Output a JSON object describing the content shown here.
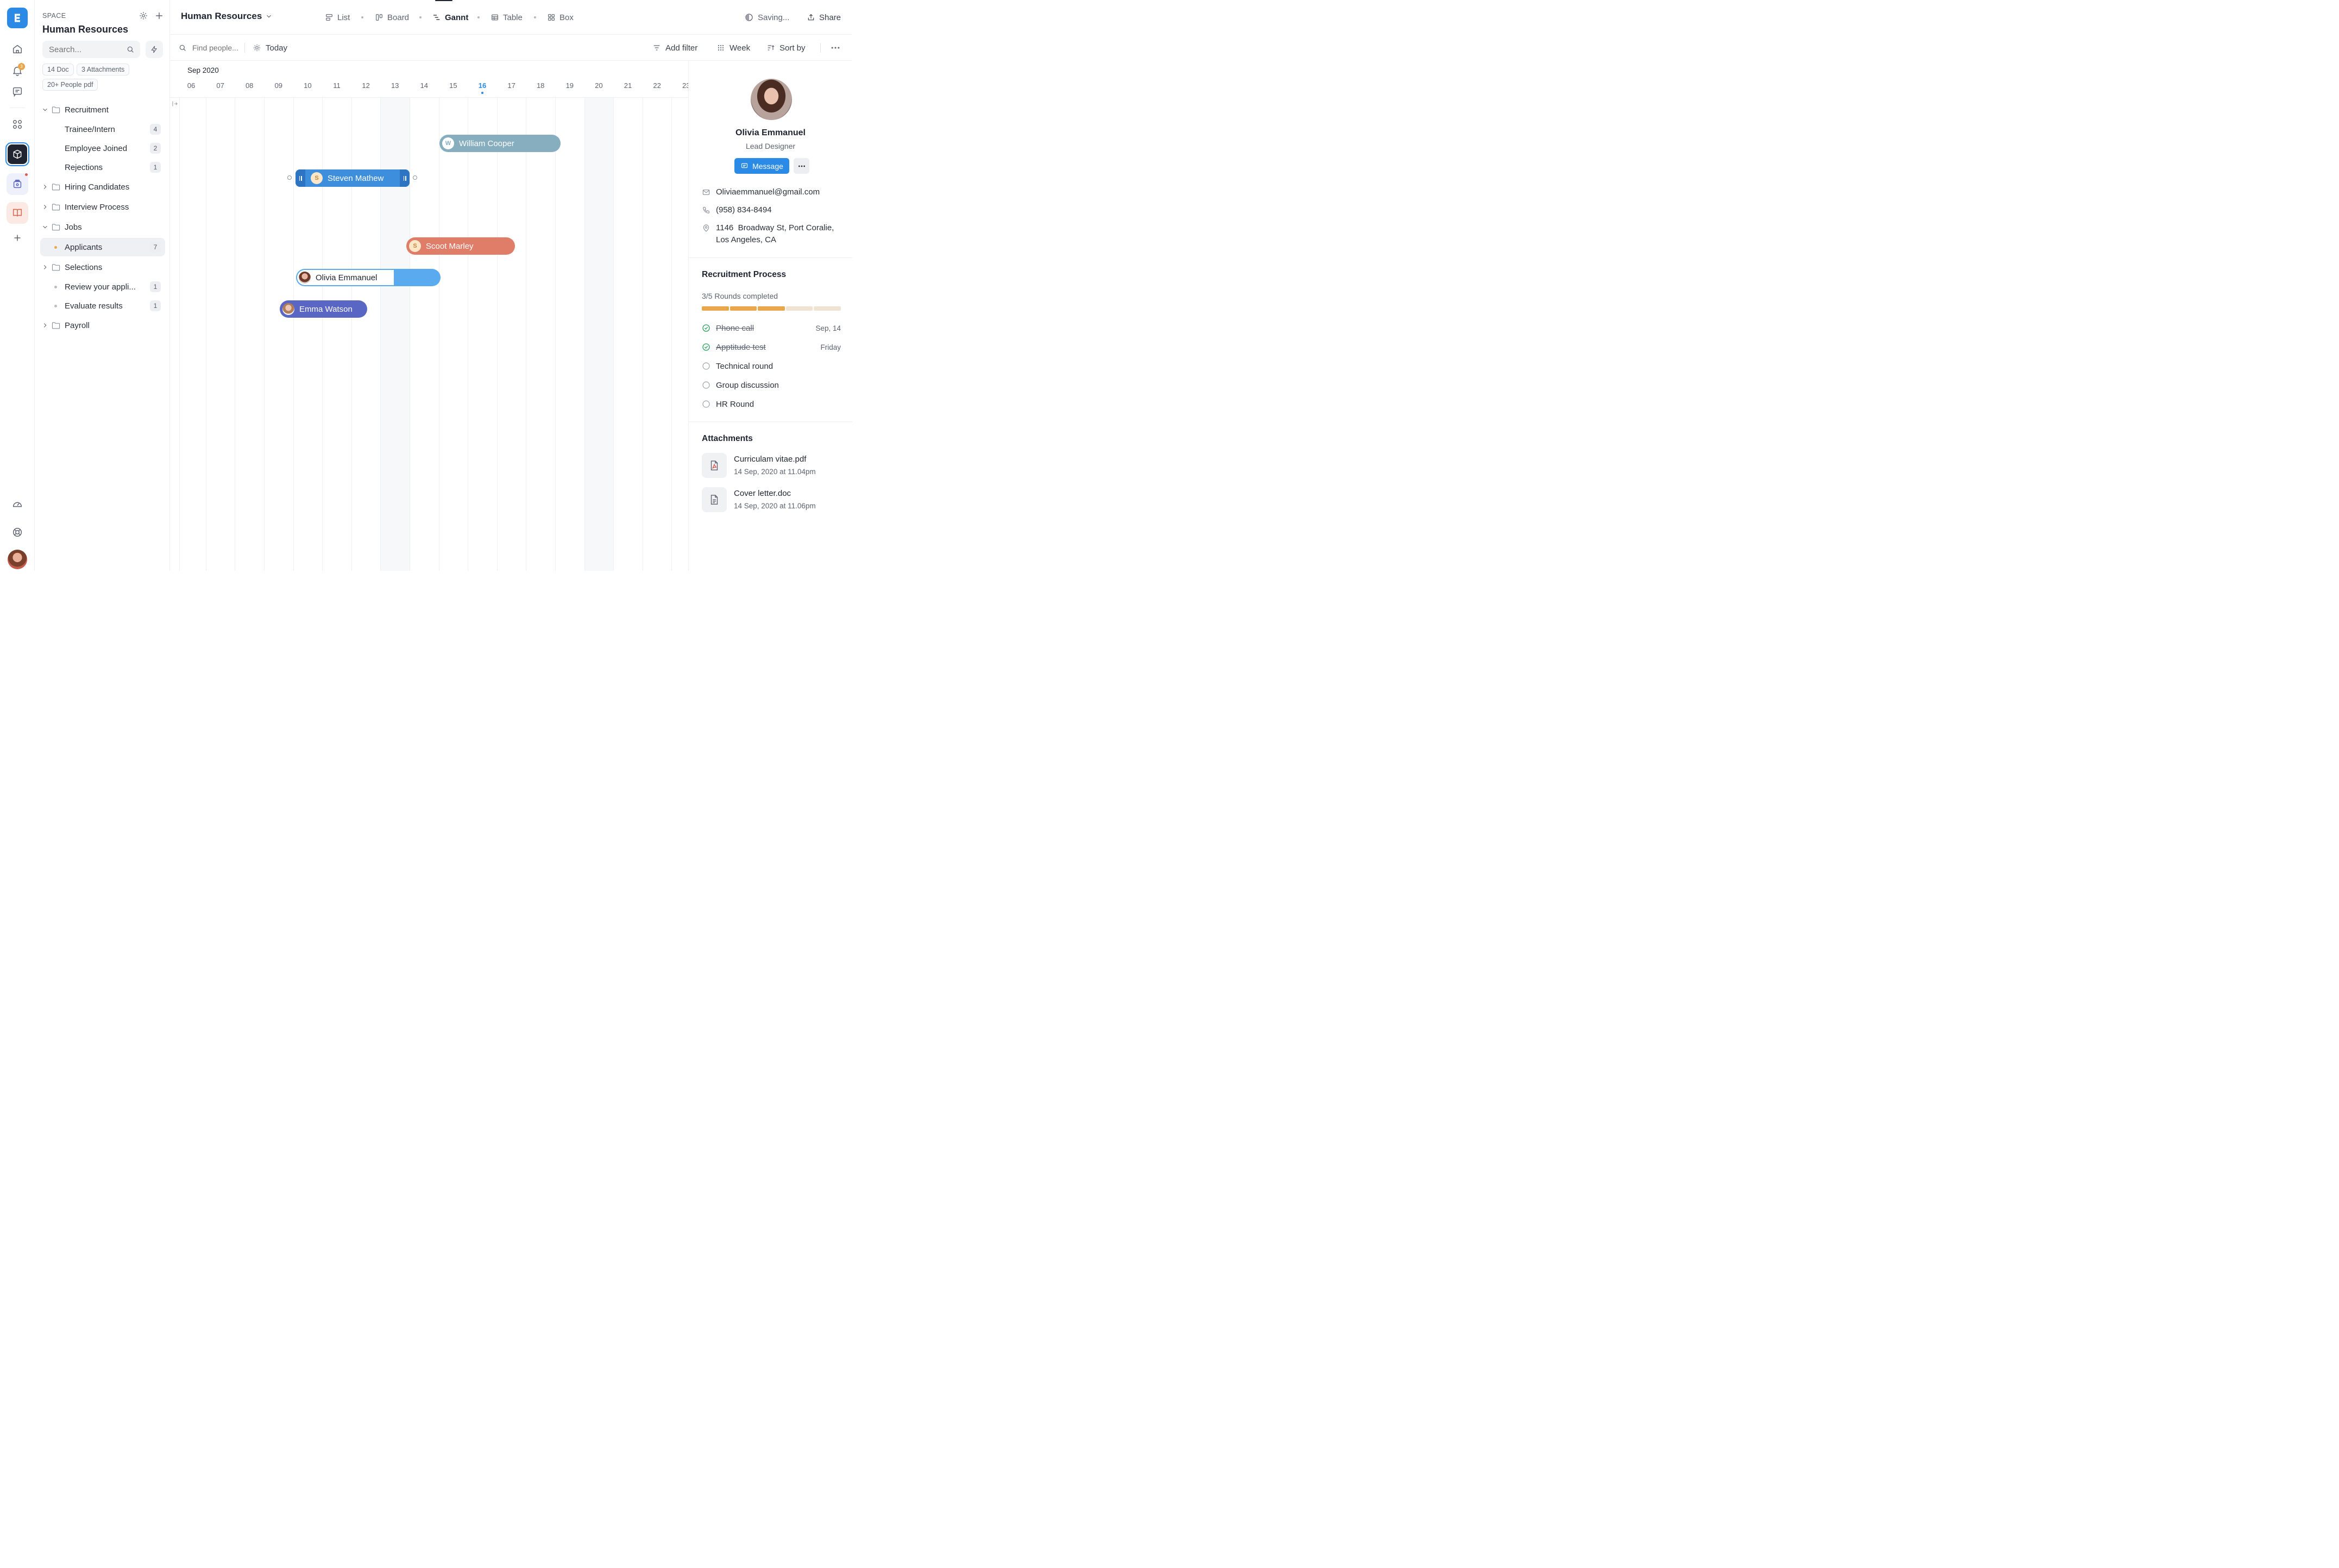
{
  "rail": {
    "notification_count": "3"
  },
  "sidebar": {
    "space_label": "SPACE",
    "space_name": "Human Resources",
    "search_placeholder": "Search...",
    "chips": [
      "14 Doc",
      "3 Attachments",
      "20+ People pdf"
    ],
    "tree": [
      {
        "label": "Recruitment",
        "type": "folder",
        "expanded": true
      },
      {
        "label": "Trainee/Intern",
        "type": "item",
        "count": "4"
      },
      {
        "label": "Employee Joined",
        "type": "item",
        "count": "2"
      },
      {
        "label": "Rejections",
        "type": "item",
        "count": "1"
      },
      {
        "label": "Hiring Candidates",
        "type": "folder",
        "expanded": false
      },
      {
        "label": "Interview Process",
        "type": "folder",
        "expanded": false
      },
      {
        "label": "Jobs",
        "type": "folder",
        "expanded": true
      },
      {
        "label": "Applicants",
        "type": "bullet",
        "count": "7",
        "active": true
      },
      {
        "label": "Selections",
        "type": "folder",
        "expanded": false
      },
      {
        "label": "Review your appli...",
        "type": "bullet",
        "count": "1"
      },
      {
        "label": "Evaluate results",
        "type": "bullet",
        "count": "1"
      },
      {
        "label": "Payroll",
        "type": "folder",
        "expanded": false
      }
    ]
  },
  "header": {
    "title": "Human Resources",
    "views": [
      "List",
      "Board",
      "Gannt",
      "Table",
      "Box"
    ],
    "active_view": "Gannt",
    "status": "Saving...",
    "share_label": "Share"
  },
  "toolbar": {
    "find_placeholder": "Find people...",
    "today_label": "Today",
    "add_filter_label": "Add filter",
    "week_label": "Week",
    "sort_label": "Sort by"
  },
  "gantt": {
    "month": "Sep 2020",
    "days": [
      "06",
      "07",
      "08",
      "09",
      "10",
      "11",
      "12",
      "13",
      "14",
      "15",
      "16",
      "17",
      "18",
      "19",
      "20",
      "21",
      "22",
      "23"
    ],
    "today": "16",
    "bars": [
      {
        "name": "William Cooper",
        "initial": "W",
        "color": "#86aebf"
      },
      {
        "name": "Steven Mathew",
        "initial": "S",
        "color": "#3d8fde"
      },
      {
        "name": "Scoot Marley",
        "initial": "S",
        "color": "#e07d68"
      },
      {
        "name": "Olivia Emmanuel",
        "initial": "",
        "color": "#5aaaf0"
      },
      {
        "name": "Emma Watson",
        "initial": "",
        "color": "#5966c4"
      }
    ]
  },
  "profile": {
    "name": "Olivia Emmanuel",
    "role": "Lead Designer",
    "message_label": "Message",
    "email": "Oliviaemmanuel@gmail.com",
    "phone": "(958) 834-8494",
    "address_line1": "1146  Broadway St, Port Coralie,",
    "address_line2": "Los Angeles, CA"
  },
  "recruitment": {
    "title": "Recruitment Process",
    "progress_text": "3/5 Rounds completed",
    "segments_completed": 3,
    "segments_total": 5,
    "rounds": [
      {
        "label": "Phone call",
        "done": true,
        "date": "Sep, 14"
      },
      {
        "label": "Apptitude test",
        "done": true,
        "date": "Friday"
      },
      {
        "label": "Technical round",
        "done": false,
        "date": ""
      },
      {
        "label": "Group discussion",
        "done": false,
        "date": ""
      },
      {
        "label": "HR Round",
        "done": false,
        "date": ""
      }
    ]
  },
  "attachments": {
    "title": "Attachments",
    "files": [
      {
        "name": "Curriculam vitae.pdf",
        "date": "14 Sep, 2020 at 11.04pm",
        "kind": "pdf"
      },
      {
        "name": "Cover letter.doc",
        "date": "14 Sep, 2020 at 11.06pm",
        "kind": "doc"
      }
    ]
  },
  "colors": {
    "brand": "#2b8ae6",
    "progress_done": "#e8a74a",
    "progress_todo": "#efe4d2",
    "check_green": "#2aa35c"
  }
}
